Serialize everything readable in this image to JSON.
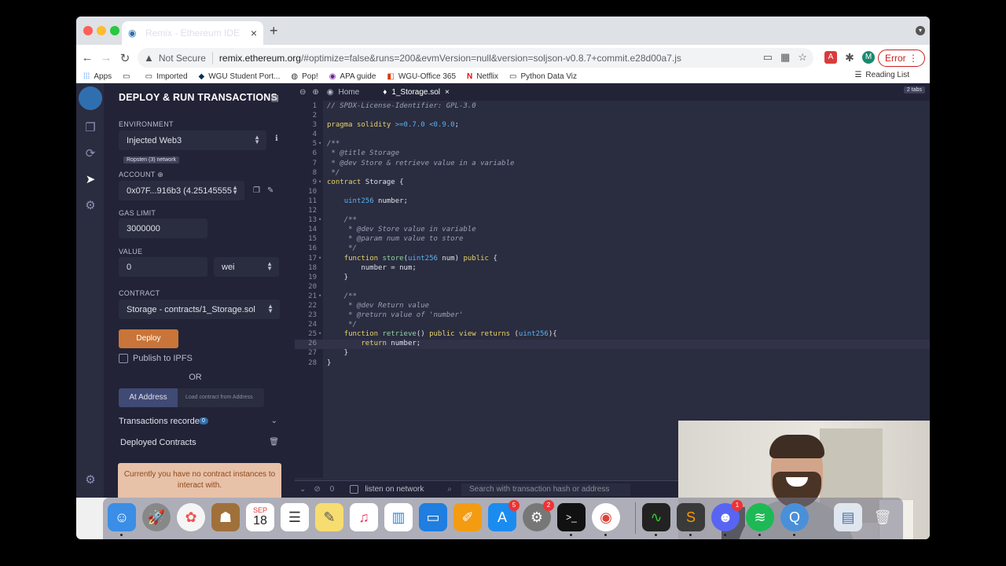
{
  "browser": {
    "tab_title": "Remix - Ethereum IDE",
    "security": "Not Secure",
    "url_host": "remix.ethereum.org",
    "url_rest": "/#optimize=false&runs=200&evmVersion=null&version=soljson-v0.8.7+commit.e28d00a7.js",
    "error_label": "Error",
    "profile_initial": "M",
    "bookmarks": [
      "Apps",
      "Imported",
      "WGU Student Port...",
      "Pop!",
      "APA guide",
      "WGU-Office 365",
      "Netflix",
      "Python Data Viz"
    ],
    "reading_list": "Reading List"
  },
  "deploy": {
    "title": "DEPLOY & RUN TRANSACTIONS",
    "environment_label": "ENVIRONMENT",
    "environment_value": "Injected Web3",
    "network_badge": "Ropsten (3) network",
    "account_label": "ACCOUNT",
    "account_value": "0x07F...916b3 (4.25145555",
    "gas_label": "GAS LIMIT",
    "gas_value": "3000000",
    "value_label": "VALUE",
    "value_amount": "0",
    "value_unit": "wei",
    "contract_label": "CONTRACT",
    "contract_value": "Storage - contracts/1_Storage.sol",
    "deploy_button": "Deploy",
    "publish_label": "Publish to IPFS",
    "or_label": "OR",
    "at_address_button": "At Address",
    "load_contract_placeholder": "Load contract from Address",
    "transactions_recorded": "Transactions recorded",
    "transactions_count": "0",
    "deployed_contracts": "Deployed Contracts",
    "no_contract_msg": "Currently you have no contract instances to interact with."
  },
  "editor": {
    "home_tab": "Home",
    "file_tab": "1_Storage.sol",
    "tabs_badge": "2 tabs",
    "terminal_count": "0",
    "listen_label": "listen on network",
    "search_placeholder": "Search with transaction hash or address"
  },
  "code_lines": [
    "// SPDX-License-Identifier: GPL-3.0",
    "",
    "pragma solidity >=0.7.0 <0.9.0;",
    "",
    "/**",
    " * @title Storage",
    " * @dev Store & retrieve value in a variable",
    " */",
    "contract Storage {",
    "",
    "    uint256 number;",
    "",
    "    /**",
    "     * @dev Store value in variable",
    "     * @param num value to store",
    "     */",
    "    function store(uint256 num) public {",
    "        number = num;",
    "    }",
    "",
    "    /**",
    "     * @dev Return value",
    "     * @return value of 'number'",
    "     */",
    "    function retrieve() public view returns (uint256){",
    "        return number;",
    "    }",
    "}"
  ],
  "dock": {
    "calendar_month": "SEP",
    "calendar_day": "18",
    "badges": {
      "appstore": "5",
      "settings": "2",
      "discord": "1"
    }
  }
}
